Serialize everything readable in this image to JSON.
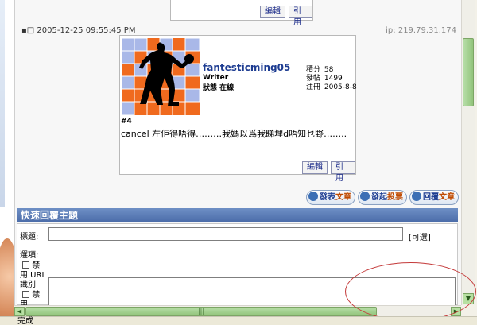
{
  "top_post": {
    "edit_label": "編輯",
    "quote_label": "引用"
  },
  "post": {
    "date": "2005-12-25 09:55:45 PM",
    "ip": "ip: 219.79.31.174",
    "username": "fantesticming05",
    "rank": "Writer",
    "status": "狀態 在線",
    "stats": [
      {
        "label": "積分",
        "value": "58"
      },
      {
        "label": "發帖",
        "value": "1499"
      },
      {
        "label": "注冊",
        "value": "2005-8-8"
      }
    ],
    "number": "#4",
    "content": "cancel 左佢得唔得………我媽以爲我睇埋d唔知乜野……..",
    "edit_label": "編輯",
    "quote_label": "引用"
  },
  "actions": [
    {
      "part1": "發表",
      "part2": "文章"
    },
    {
      "part1": "發起",
      "part2": "投票"
    },
    {
      "part1": "回覆",
      "part2": "文章"
    }
  ],
  "quick_reply": {
    "header": "快速回覆主題",
    "title_label": "標題:",
    "optional": "[可選]",
    "options_label": "選項:",
    "opt1_a": "禁",
    "opt1_b": "用 URL",
    "opt1_c": "識別",
    "opt2_a": "禁",
    "opt2_b": "用"
  },
  "status": "完成"
}
